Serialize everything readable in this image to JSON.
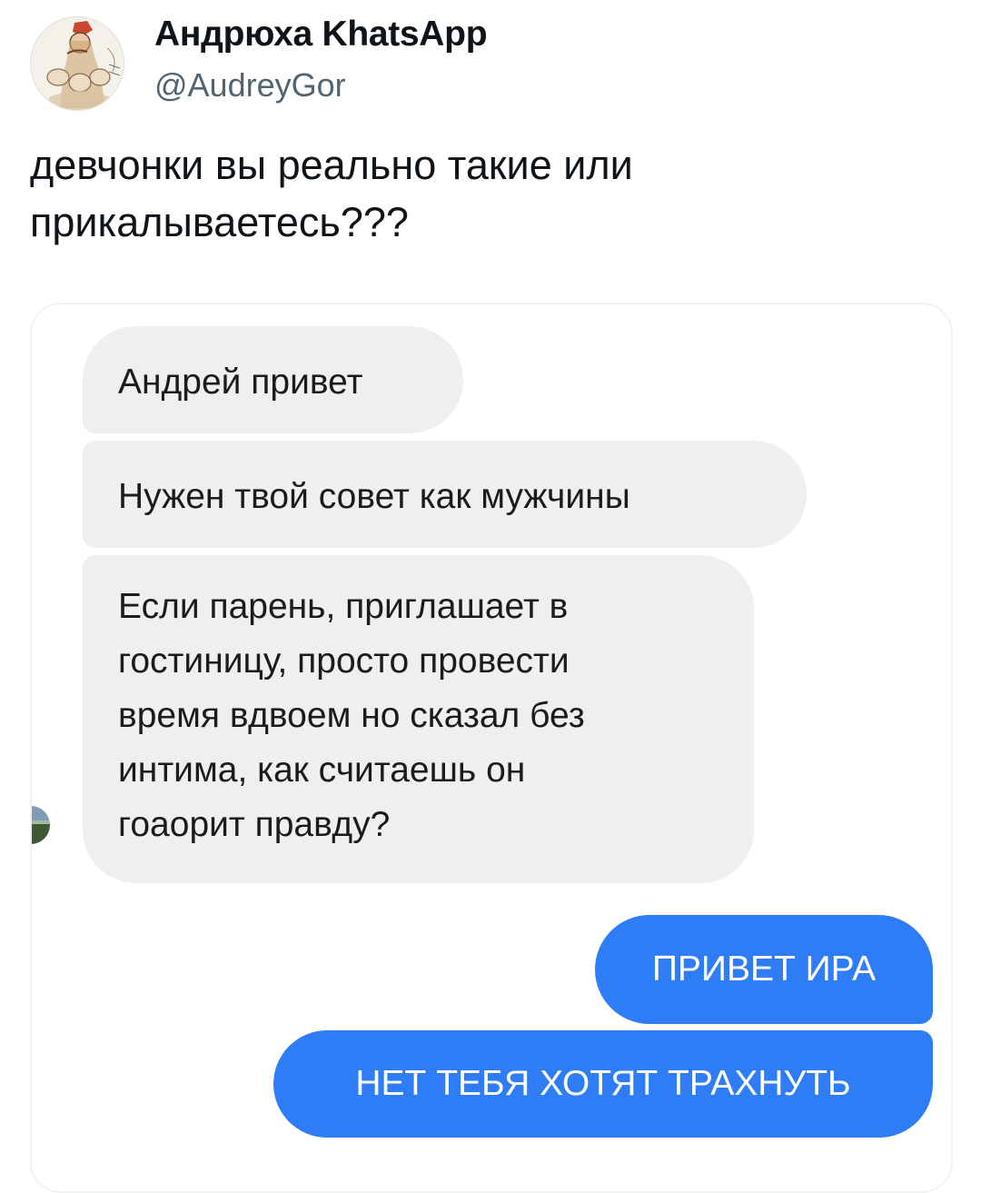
{
  "tweet": {
    "display_name": "Андрюха KhatsApp",
    "handle": "@AudreyGor",
    "text_lines": [
      "девчонки вы реально такие или",
      "прикалываетесь???"
    ]
  },
  "chat": {
    "incoming": [
      {
        "lines": [
          "Андрей привет"
        ]
      },
      {
        "lines": [
          "Нужен твой совет как мужчины"
        ]
      },
      {
        "lines": [
          "Если парень, приглашает в",
          "гостиницу, просто провести",
          "время вдвоем но сказал без",
          "интима, как считаешь он",
          "гоаорит правду?"
        ]
      }
    ],
    "outgoing": [
      {
        "lines": [
          "ПРИВЕТ ИРА"
        ]
      },
      {
        "lines": [
          "НЕТ ТЕБЯ ХОТЯТ ТРАХНУТЬ"
        ]
      }
    ]
  },
  "colors": {
    "outgoing_bubble": "#2f7df6",
    "incoming_bubble": "#efefef",
    "handle_text": "#536471"
  },
  "icons": {
    "avatar": "illustrated-profile-avatar",
    "contact": "contact-photo-avatar"
  }
}
